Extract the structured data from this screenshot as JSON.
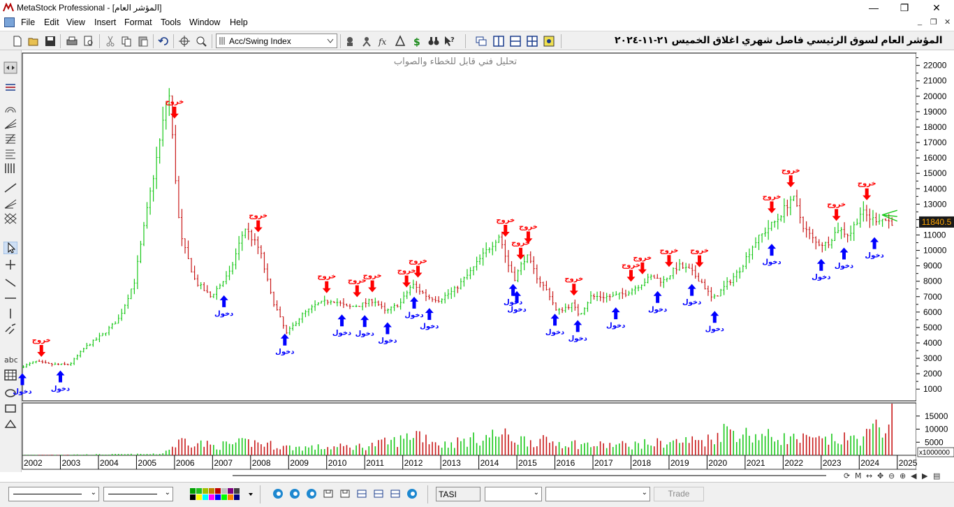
{
  "window": {
    "title": "MetaStock Professional - [المؤشر العام]",
    "minimize": "—",
    "restore": "❐",
    "close": "✕"
  },
  "menu": {
    "items": [
      "File",
      "Edit",
      "View",
      "Insert",
      "Format",
      "Tools",
      "Window",
      "Help"
    ],
    "mdi_minimize": "_",
    "mdi_restore": "❐",
    "mdi_close": "✕"
  },
  "toolbar": {
    "indicator_value": "Acc/Swing Index",
    "chart_title": "المؤشر العام لسوق الرئيسي فاصل شهري اغلاق الخميس ٢١-١١-٢٠٢٤",
    "icons": [
      "new-icon",
      "open-icon",
      "save-icon",
      "print-icon",
      "print-preview-icon",
      "cut-icon",
      "copy-icon",
      "paste-icon",
      "undo-icon",
      "crosshair-icon",
      "zoom-icon",
      "expert-icon",
      "explorer-icon",
      "formula-icon",
      "system-tester-icon",
      "dollar-icon",
      "binoculars-icon",
      "help-pointer-icon",
      "tile-icon",
      "vertical-split-icon",
      "horizontal-split-icon",
      "grid-icon",
      "layout-icon"
    ]
  },
  "chart": {
    "watermark": "تحليل فني قابل للخطاء والصواب",
    "last_price": "11840.5",
    "volume_scale": "x1000000",
    "entry_label": "دخول",
    "exit_label": "خروج",
    "colors": {
      "up": "#18c818",
      "down": "#c81818",
      "entry_arrow": "#0000ff",
      "exit_arrow": "#ff0000",
      "price_tag_bg": "#1a1a1a",
      "price_tag_fg": "#ffa500"
    }
  },
  "chart_data": {
    "type": "bar",
    "title": "المؤشر العام لسوق الرئيسي فاصل شهري اغلاق الخميس ٢١-١١-٢٠٢٤",
    "xlabel": "",
    "ylabel": "",
    "x_ticks": [
      "2002",
      "2003",
      "2004",
      "2005",
      "2006",
      "2007",
      "2008",
      "2009",
      "2010",
      "2011",
      "2012",
      "2013",
      "2014",
      "2015",
      "2016",
      "2017",
      "2018",
      "2019",
      "2020",
      "2021",
      "2022",
      "2023",
      "2024",
      "2025"
    ],
    "y_ticks": [
      1000,
      2000,
      3000,
      4000,
      5000,
      6000,
      7000,
      8000,
      9000,
      10000,
      11000,
      12000,
      13000,
      14000,
      15000,
      16000,
      17000,
      18000,
      19000,
      20000,
      21000,
      22000
    ],
    "ylim": [
      240,
      22800
    ],
    "xlim": [
      2002.0,
      2025.5
    ],
    "volume_ticks": [
      5000,
      10000,
      15000
    ],
    "volume_ylim": [
      0,
      20000
    ],
    "price_keypoints": [
      [
        2002.0,
        2400
      ],
      [
        2002.4,
        2800
      ],
      [
        2002.8,
        2600
      ],
      [
        2003.3,
        2600
      ],
      [
        2003.7,
        3700
      ],
      [
        2004.2,
        4600
      ],
      [
        2004.6,
        5600
      ],
      [
        2005.0,
        8000
      ],
      [
        2005.4,
        13500
      ],
      [
        2005.7,
        17500
      ],
      [
        2005.9,
        20500
      ],
      [
        2006.2,
        11000
      ],
      [
        2006.6,
        8000
      ],
      [
        2007.0,
        7000
      ],
      [
        2007.5,
        8500
      ],
      [
        2007.9,
        11500
      ],
      [
        2008.3,
        10000
      ],
      [
        2008.6,
        7000
      ],
      [
        2009.0,
        4600
      ],
      [
        2009.4,
        5800
      ],
      [
        2009.8,
        6500
      ],
      [
        2010.2,
        6800
      ],
      [
        2010.6,
        6300
      ],
      [
        2011.0,
        6500
      ],
      [
        2011.3,
        6800
      ],
      [
        2011.6,
        6000
      ],
      [
        2012.0,
        6600
      ],
      [
        2012.3,
        7800
      ],
      [
        2012.7,
        7000
      ],
      [
        2013.0,
        6800
      ],
      [
        2013.4,
        7400
      ],
      [
        2013.8,
        8500
      ],
      [
        2014.2,
        9800
      ],
      [
        2014.6,
        11000
      ],
      [
        2014.8,
        9200
      ],
      [
        2015.0,
        8200
      ],
      [
        2015.3,
        9700
      ],
      [
        2015.6,
        8200
      ],
      [
        2015.9,
        7200
      ],
      [
        2016.1,
        6000
      ],
      [
        2016.5,
        6500
      ],
      [
        2016.7,
        5800
      ],
      [
        2017.0,
        7000
      ],
      [
        2017.5,
        7000
      ],
      [
        2017.9,
        7200
      ],
      [
        2018.3,
        7800
      ],
      [
        2018.6,
        8300
      ],
      [
        2018.9,
        8000
      ],
      [
        2019.3,
        9000
      ],
      [
        2019.6,
        8700
      ],
      [
        2019.9,
        8000
      ],
      [
        2020.2,
        6800
      ],
      [
        2020.5,
        7600
      ],
      [
        2020.9,
        8700
      ],
      [
        2021.3,
        10500
      ],
      [
        2021.6,
        11300
      ],
      [
        2021.9,
        12000
      ],
      [
        2022.3,
        13500
      ],
      [
        2022.6,
        11500
      ],
      [
        2022.9,
        10500
      ],
      [
        2023.2,
        10400
      ],
      [
        2023.5,
        11400
      ],
      [
        2023.8,
        11000
      ],
      [
        2024.1,
        12500
      ],
      [
        2024.4,
        12000
      ],
      [
        2024.6,
        12100
      ],
      [
        2024.88,
        11840
      ]
    ],
    "volume_keypoints": [
      [
        2002.0,
        150
      ],
      [
        2005.6,
        500
      ],
      [
        2005.9,
        3000
      ],
      [
        2006.2,
        6000
      ],
      [
        2007.0,
        3500
      ],
      [
        2008.0,
        5000
      ],
      [
        2009.0,
        3000
      ],
      [
        2010.0,
        3000
      ],
      [
        2011.0,
        3500
      ],
      [
        2012.0,
        6000
      ],
      [
        2012.3,
        9000
      ],
      [
        2013.0,
        4000
      ],
      [
        2014.0,
        6500
      ],
      [
        2014.5,
        8000
      ],
      [
        2015.0,
        6000
      ],
      [
        2016.0,
        5000
      ],
      [
        2017.0,
        3800
      ],
      [
        2018.0,
        4000
      ],
      [
        2019.0,
        5000
      ],
      [
        2020.0,
        6000
      ],
      [
        2020.5,
        10000
      ],
      [
        2021.0,
        8000
      ],
      [
        2022.0,
        6500
      ],
      [
        2023.0,
        5500
      ],
      [
        2024.0,
        6500
      ],
      [
        2024.7,
        12000
      ],
      [
        2024.8,
        20000
      ],
      [
        2024.88,
        11000
      ]
    ],
    "exit_signals": [
      2002.5,
      2006.0,
      2008.2,
      2010.0,
      2010.8,
      2011.2,
      2012.1,
      2012.4,
      2014.7,
      2015.1,
      2015.3,
      2016.5,
      2018.0,
      2018.3,
      2019.0,
      2019.8,
      2021.7,
      2022.2,
      2023.4,
      2024.2
    ],
    "entry_signals": [
      2002.0,
      2003.0,
      2007.3,
      2008.9,
      2010.4,
      2011.0,
      2011.6,
      2012.3,
      2012.7,
      2014.9,
      2015.0,
      2016.0,
      2016.6,
      2017.6,
      2018.7,
      2019.6,
      2020.2,
      2021.7,
      2023.0,
      2023.6,
      2024.4
    ]
  },
  "status": {
    "symbol": "TASI",
    "trade_label": "Trade",
    "bottom_icons": [
      "edge-icon",
      "edge-icon",
      "edge-icon",
      "layout-icon",
      "layout-icon",
      "layout-icon",
      "layout-icon",
      "layout-icon",
      "edge-icon"
    ]
  }
}
